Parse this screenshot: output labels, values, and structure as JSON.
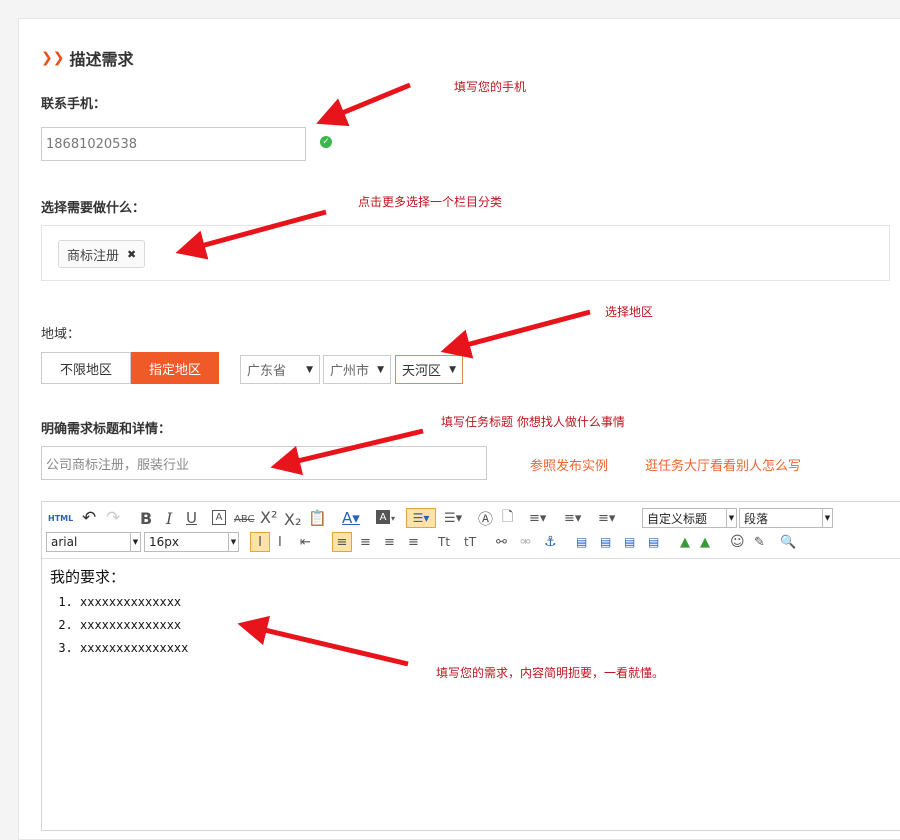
{
  "section": {
    "title": "描述需求"
  },
  "phone": {
    "label": "联系手机：",
    "value": "18681020538",
    "annotation": "填写您的手机"
  },
  "category": {
    "label": "选择需要做什么：",
    "tag": "商标注册",
    "annotation": "点击更多选择一个栏目分类"
  },
  "region": {
    "label": "地域：",
    "buttons": [
      "不限地区",
      "指定地区"
    ],
    "province": "广东省",
    "city": "广州市",
    "district": "天河区",
    "annotation": "选择地区"
  },
  "title_field": {
    "label": "明确需求标题和详情：",
    "placeholder": "公司商标注册，服装行业",
    "annotation": "填写任务标题 你想找人做什么事情",
    "link1": "参照发布实例",
    "link2": "逛任务大厅看看别人怎么写"
  },
  "editor": {
    "toolbar": {
      "html": "HTML",
      "bold": "B",
      "italic": "I",
      "underline": "U",
      "abc": "ABC",
      "heading_select": "自定义标题",
      "paragraph_select": "段落",
      "font_select": "arial",
      "size_select": "16px"
    },
    "content_heading": "我的要求：",
    "items": [
      "xxxxxxxxxxxxxx",
      "xxxxxxxxxxxxxx",
      "xxxxxxxxxxxxxxx"
    ],
    "annotation": "填写您的需求，内容简明扼要，一看就懂。"
  },
  "colors": {
    "accent": "#f05a28",
    "annotation": "#c0141e",
    "arrow": "#e8141c"
  }
}
